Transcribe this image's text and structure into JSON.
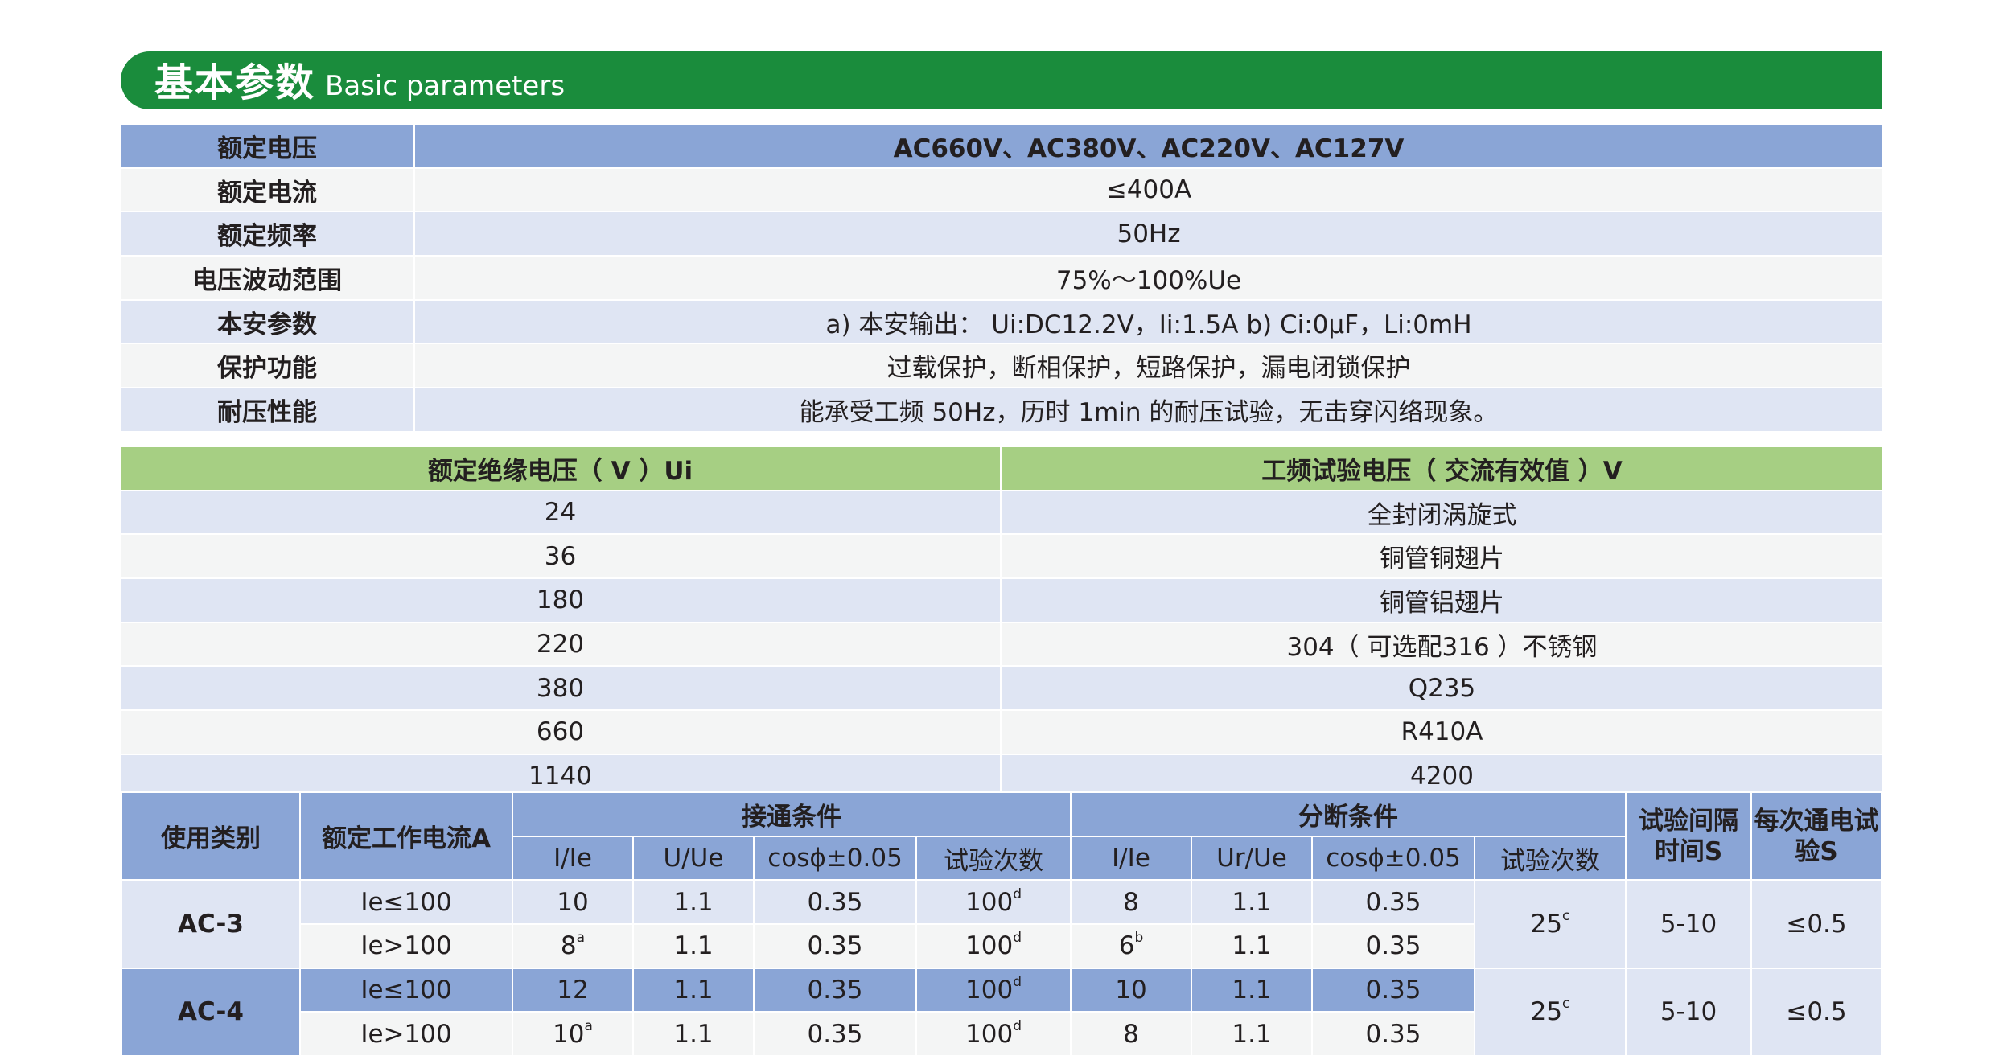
{
  "header": {
    "title_zh": "基本参数",
    "title_en": "Basic  parameters"
  },
  "table1": {
    "rows": [
      {
        "label": "额定电压",
        "value": "AC660V、AC380V、AC220V、AC127V"
      },
      {
        "label": "额定电流",
        "value": "≤400A"
      },
      {
        "label": "额定频率",
        "value": "50Hz"
      },
      {
        "label": "电压波动范围",
        "value": "75%～100%Ue"
      },
      {
        "label": "本安参数",
        "value": "a) 本安输出： Ui:DC12.2V，Ii:1.5A b) Ci:0μF，Li:0mH"
      },
      {
        "label": "保护功能",
        "value": "过载保护，断相保护，短路保护，漏电闭锁保护"
      },
      {
        "label": "耐压性能",
        "value": "能承受工频 50Hz，历时 1min 的耐压试验，无击穿闪络现象。"
      }
    ]
  },
  "table2": {
    "headers": [
      "额定绝缘电压（ V ）Ui",
      "工频试验电压（ 交流有效值 ）V"
    ],
    "rows": [
      [
        "24",
        "全封闭涡旋式"
      ],
      [
        "36",
        "铜管铜翅片"
      ],
      [
        "180",
        "铜管铝翅片"
      ],
      [
        "220",
        "304（ 可选配316 ）不锈钢"
      ],
      [
        "380",
        "Q235"
      ],
      [
        "660",
        "R410A"
      ],
      [
        "1140",
        "4200"
      ]
    ]
  },
  "table3": {
    "h_category": "使用类别",
    "h_current": "额定工作电流A",
    "h_make": "接通条件",
    "h_break": "分断条件",
    "h_interval": "试验间隔时间S",
    "h_energize": "每次通电试验S",
    "sub": {
      "make": [
        "I/Ie",
        "U/Ue",
        "cosϕ±0.05",
        "试验次数"
      ],
      "break": [
        "I/Ie",
        "Ur/Ue",
        "cosϕ±0.05",
        "试验次数"
      ]
    },
    "groups": [
      {
        "category": "AC-3",
        "break_count": "25",
        "break_count_sup": "c",
        "interval": "5-10",
        "energize": "≤0.5",
        "rows": [
          {
            "current": "Ie≤100",
            "make_i": "10",
            "make_i_sup": "",
            "make_u": "1.1",
            "make_cos": "0.35",
            "make_count": "100",
            "make_count_sup": "d",
            "break_i": "8",
            "break_i_sup": "",
            "break_u": "1.1",
            "break_cos": "0.35"
          },
          {
            "current": "Ie>100",
            "make_i": "8",
            "make_i_sup": "a",
            "make_u": "1.1",
            "make_cos": "0.35",
            "make_count": "100",
            "make_count_sup": "d",
            "break_i": "6",
            "break_i_sup": "b",
            "break_u": "1.1",
            "break_cos": "0.35"
          }
        ]
      },
      {
        "category": "AC-4",
        "break_count": "25",
        "break_count_sup": "c",
        "interval": "5-10",
        "energize": "≤0.5",
        "rows": [
          {
            "current": "Ie≤100",
            "make_i": "12",
            "make_i_sup": "",
            "make_u": "1.1",
            "make_cos": "0.35",
            "make_count": "100",
            "make_count_sup": "d",
            "break_i": "10",
            "break_i_sup": "",
            "break_u": "1.1",
            "break_cos": "0.35"
          },
          {
            "current": "Ie>100",
            "make_i": "10",
            "make_i_sup": "a",
            "make_u": "1.1",
            "make_cos": "0.35",
            "make_count": "100",
            "make_count_sup": "d",
            "break_i": "8",
            "break_i_sup": "",
            "break_u": "1.1",
            "break_cos": "0.35"
          }
        ]
      }
    ]
  },
  "colors": {
    "banner": "#1a8c3c",
    "header_blue": "#8aa5d6",
    "row_light": "#dfe5f3",
    "row_white": "#f4f5f5",
    "header_green": "#a6cf83"
  }
}
